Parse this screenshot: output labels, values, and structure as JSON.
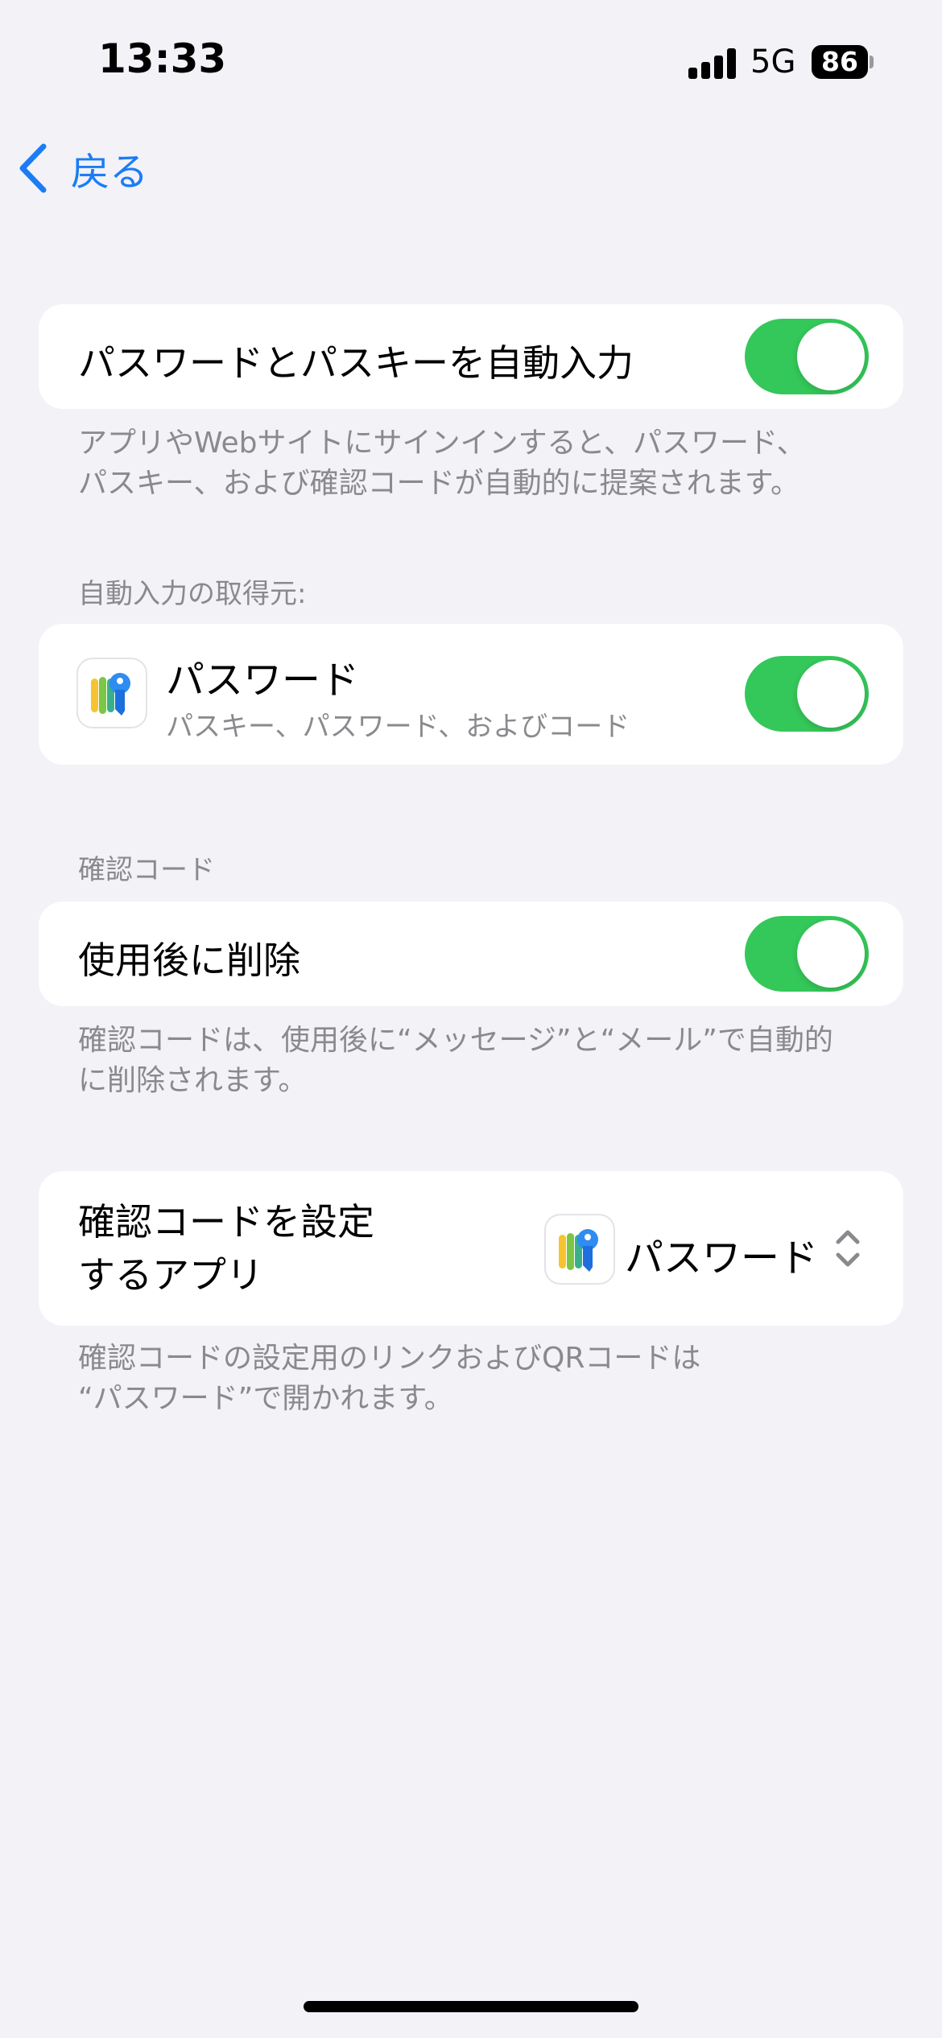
{
  "status_bar": {
    "time": "13:33",
    "network": "5G",
    "battery": "86"
  },
  "nav": {
    "back_label": "戻る"
  },
  "autofill": {
    "title": "パスワードとパスキーを自動入力",
    "enabled": true,
    "caption_line1": "アプリやWebサイトにサインインすると、パスワード、",
    "caption_line2": "パスキー、および確認コードが自動的に提案されます。"
  },
  "sources": {
    "header": "自動入力の取得元:",
    "app_title": "パスワード",
    "app_subtitle": "パスキー、パスワード、およびコード",
    "enabled": true
  },
  "codes": {
    "header": "確認コード",
    "delete_title": "使用後に削除",
    "enabled": true,
    "caption_line1": "確認コードは、使用後に“メッセージ”と“メール”で自動的",
    "caption_line2": "に削除されます。"
  },
  "setup_app": {
    "label_line1": "確認コードを設定",
    "label_line2": "するアプリ",
    "value": "パスワード",
    "caption_line1": "確認コードの設定用のリンクおよびQRコードは",
    "caption_line2": "“パスワード”で開かれます。"
  },
  "colors": {
    "accent": "#1C7CF5",
    "toggle_on": "#34C759",
    "background": "#F2F2F7",
    "secondary_text": "#8A8A8E"
  },
  "icons": {
    "back": "chevron-left-icon",
    "app": "passwords-app-icon",
    "popup": "chevron-up-down-icon"
  }
}
